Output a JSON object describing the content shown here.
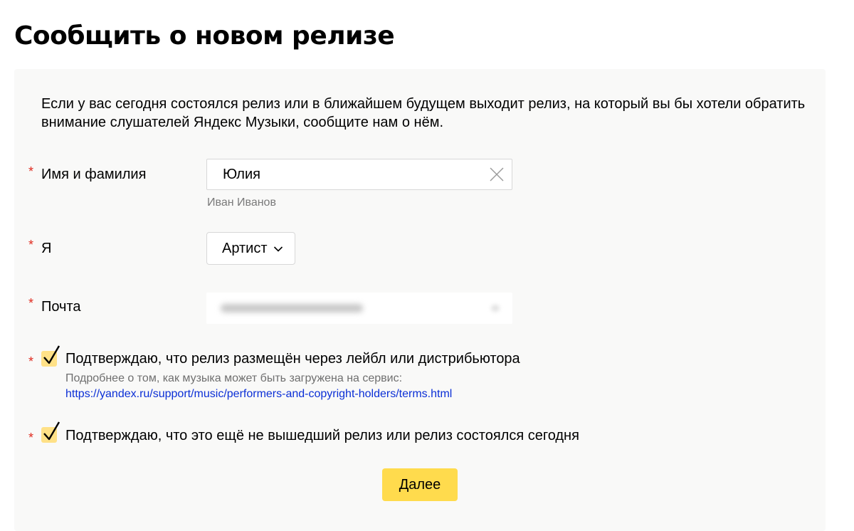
{
  "page": {
    "title": "Сообщить о новом релизе"
  },
  "form": {
    "intro": "Если у вас сегодня состоялся релиз или в ближайшем будущем выходит релиз, на который вы бы хотели обратить внимание слушателей Яндекс Музыки, сообщите нам о нём.",
    "required_mark": "*",
    "name": {
      "label": "Имя и фамилия",
      "value": "Юлия",
      "hint": "Иван Иванов"
    },
    "role": {
      "label": "Я",
      "selected": "Артист"
    },
    "email": {
      "label": "Почта"
    },
    "confirm_distribution": {
      "label": "Подтверждаю, что релиз размещён через лейбл или дистрибьютора",
      "hint": "Подробнее о том, как музыка может быть загружена на сервис:",
      "link": "https://yandex.ru/support/music/performers-and-copyright-holders/terms.html",
      "checked": true
    },
    "confirm_unreleased": {
      "label": "Подтверждаю, что это ещё не вышедший релиз или релиз состоялся сегодня",
      "checked": true
    },
    "submit_label": "Далее"
  },
  "colors": {
    "accent": "#ffdb4d",
    "checkbox": "#ffe187",
    "required": "#e02c20",
    "link": "#0b2fd6"
  }
}
